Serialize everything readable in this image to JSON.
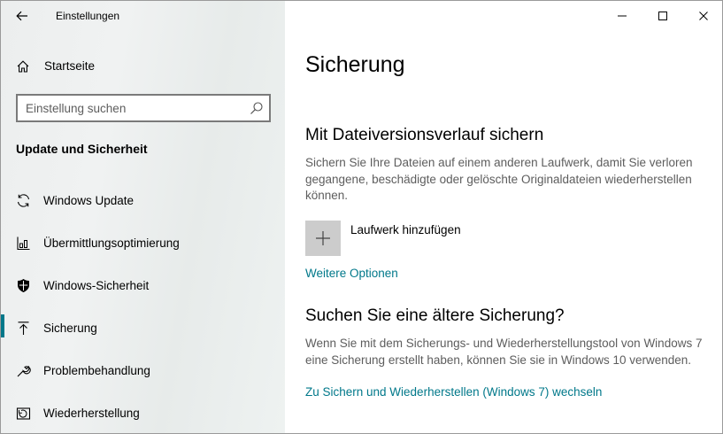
{
  "window": {
    "title": "Einstellungen"
  },
  "sidebar": {
    "home_label": "Startseite",
    "search": {
      "placeholder": "Einstellung suchen",
      "value": ""
    },
    "section_title": "Update und Sicherheit",
    "items": [
      {
        "label": "Windows Update",
        "icon": "sync-icon",
        "active": false
      },
      {
        "label": "Übermittlungsoptimierung",
        "icon": "delivery-optimization-icon",
        "active": false
      },
      {
        "label": "Windows-Sicherheit",
        "icon": "shield-icon",
        "active": false
      },
      {
        "label": "Sicherung",
        "icon": "backup-arrow-icon",
        "active": true
      },
      {
        "label": "Problembehandlung",
        "icon": "wrench-icon",
        "active": false
      },
      {
        "label": "Wiederherstellung",
        "icon": "recovery-icon",
        "active": false
      }
    ]
  },
  "main": {
    "page_title": "Sicherung",
    "file_history": {
      "heading": "Mit Dateiversionsverlauf sichern",
      "description": "Sichern Sie Ihre Dateien auf einem anderen Laufwerk, damit Sie verloren gegangene, beschädigte oder gelöschte Originaldateien wiederherstellen können.",
      "add_drive_label": "Laufwerk hinzufügen",
      "more_options_link": "Weitere Optionen"
    },
    "older_backup": {
      "heading": "Suchen Sie eine ältere Sicherung?",
      "description": "Wenn Sie mit dem Sicherungs- und Wiederherstellungstool von Windows 7 eine Sicherung erstellt haben, können Sie sie in Windows 10 verwenden.",
      "link": "Zu Sichern und Wiederherstellen (Windows 7) wechseln"
    }
  },
  "colors": {
    "accent": "#00788a",
    "sidebar_bg": "#eef0f0",
    "description_text": "#5d5d5d",
    "tile_bg": "#cccccc"
  }
}
